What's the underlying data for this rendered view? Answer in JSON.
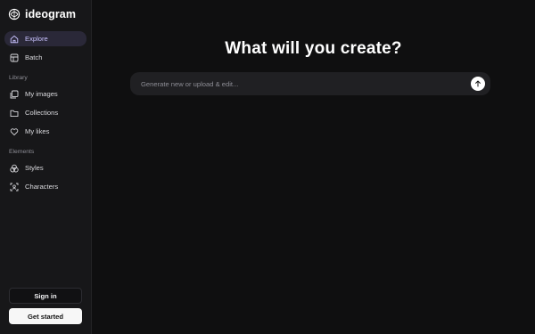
{
  "brand": {
    "name": "ideogram"
  },
  "sidebar": {
    "items": [
      {
        "label": "Explore",
        "icon": "home-icon",
        "active": true
      },
      {
        "label": "Batch",
        "icon": "batch-icon",
        "active": false
      }
    ],
    "library_label": "Library",
    "library_items": [
      {
        "label": "My images",
        "icon": "images-icon"
      },
      {
        "label": "Collections",
        "icon": "folder-icon"
      },
      {
        "label": "My likes",
        "icon": "heart-icon"
      }
    ],
    "elements_label": "Elements",
    "elements_items": [
      {
        "label": "Styles",
        "icon": "styles-icon"
      },
      {
        "label": "Characters",
        "icon": "character-icon"
      }
    ]
  },
  "auth": {
    "signin_label": "Sign in",
    "getstarted_label": "Get started"
  },
  "main": {
    "headline": "What will you create?",
    "prompt_placeholder": "Generate new or upload & edit...",
    "submit_icon": "arrow-up-icon"
  },
  "colors": {
    "background": "#0f0f10",
    "sidebar": "#171719",
    "active_item_bg": "#2a2838",
    "active_item_text": "#c9c2ff",
    "prompt_bg": "#202023"
  }
}
